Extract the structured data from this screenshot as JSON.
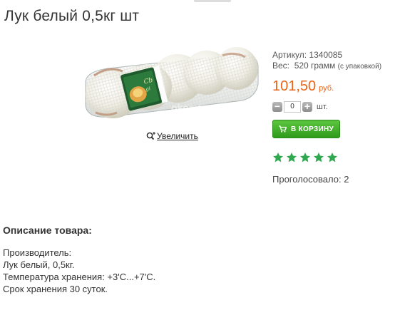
{
  "product": {
    "title": "Лук белый 0,5кг шт",
    "article_label": "Артикул:",
    "article_value": "1340085",
    "weight_label": "Вес:",
    "weight_value": "520 грамм",
    "weight_note": "(с упаковкой)",
    "price": "101,50",
    "currency": "руб.",
    "quantity_value": "0",
    "quantity_unit": "шт.",
    "minus_label": "−",
    "plus_label": "+",
    "cart_label": "В КОРЗИНУ",
    "zoom_label": "Увеличить",
    "rating": 5,
    "rating_max": 5,
    "votes_text": "Проголосовало: 2",
    "package_watermark": "okomt"
  },
  "description": {
    "heading": "Описание товара:",
    "lines": [
      "Производитель:",
      "Лук белый, 0,5кг.",
      "Температура хранения: +3'С...+7'С.",
      "Срок хранения 30 суток."
    ]
  },
  "colors": {
    "price": "#e8641b",
    "cart_button": "#3aa826",
    "stars": "#2fa84f"
  }
}
